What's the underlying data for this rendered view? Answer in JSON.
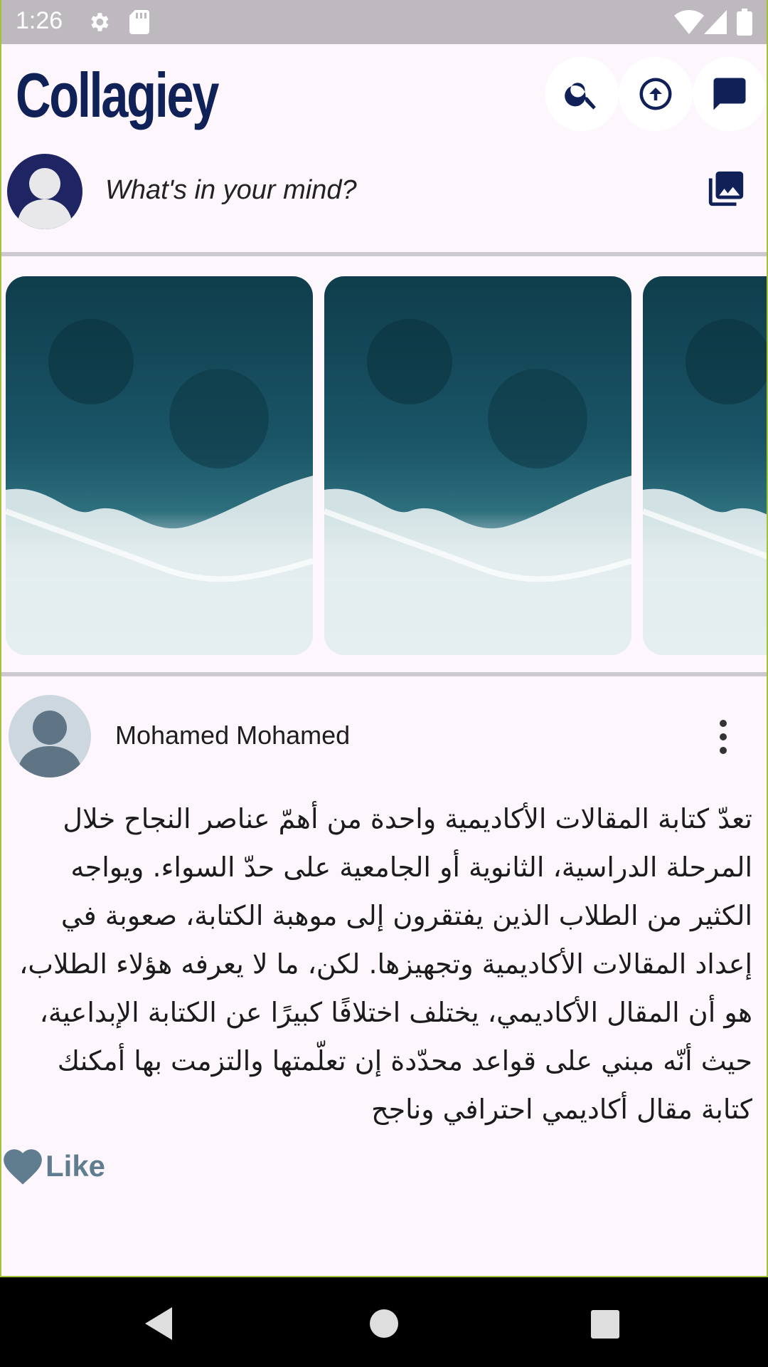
{
  "status_bar": {
    "time": "1:26",
    "icons": [
      "gear-icon",
      "sd-card-icon",
      "wifi-icon",
      "cell-signal-icon",
      "battery-icon"
    ]
  },
  "app_bar": {
    "brand": "Collagiey",
    "actions": [
      {
        "icon": "search-icon"
      },
      {
        "icon": "upload-icon"
      },
      {
        "icon": "message-icon"
      }
    ],
    "accent_color": "#0f2157"
  },
  "composer": {
    "placeholder": "What's in your mind?",
    "action_icon": "photo-library-icon"
  },
  "stories": {
    "count_visible": 3,
    "image": "ocean-waves-aerial"
  },
  "post": {
    "author": "Mohamed Mohamed",
    "body": "تعدّ كتابة المقالات الأكاديمية واحدة من أهمّ عناصر النجاح خلال المرحلة الدراسية، الثانوية أو الجامعية على حدّ السواء. ويواجه الكثير من الطلاب الذين يفتقرون إلى موهبة الكتابة، صعوبة في إعداد المقالات الأكاديمية وتجهيزها. لكن، ما لا يعرفه هؤلاء الطلاب، هو أن المقال الأكاديمي، يختلف اختلافًا كبيرًا عن الكتابة الإبداعية، حيث أنّه مبني على قواعد محدّدة إن تعلّمتها والتزمت بها أمكنك كتابة مقال أكاديمي احترافي وناجح",
    "like_label": "Like",
    "like_color": "#5f7d8e"
  },
  "nav_bar": {
    "icons": [
      "back-icon",
      "home-icon",
      "recents-icon"
    ]
  }
}
